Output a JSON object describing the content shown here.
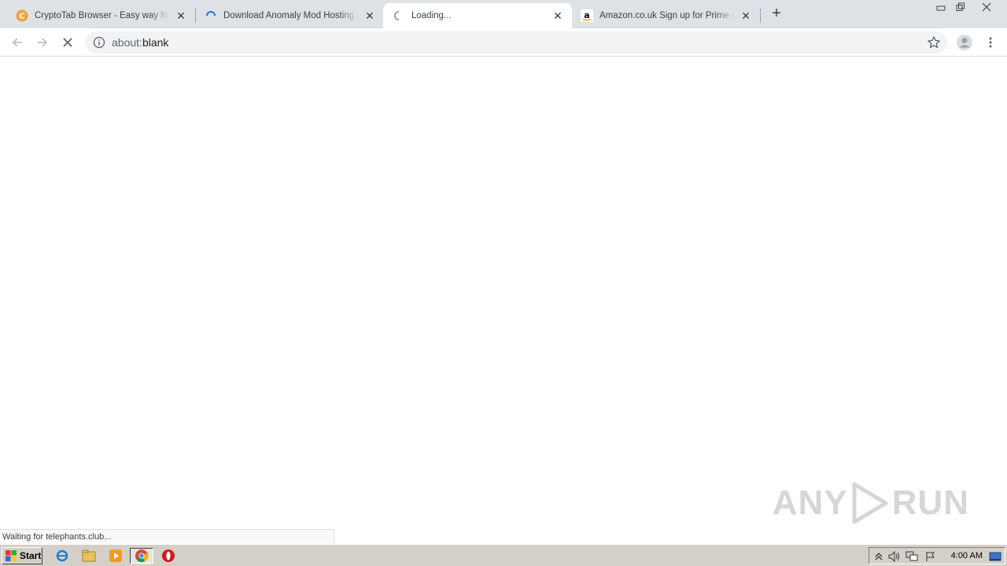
{
  "tabs": [
    {
      "title": "CryptoTab Browser - Easy way for B",
      "icon": "cryptotab-icon",
      "active": false
    },
    {
      "title": "Download Anomaly Mod Hosting mas",
      "icon": "loading-spinner-icon",
      "active": false
    },
    {
      "title": "Loading...",
      "icon": "loading-spinner-icon",
      "active": true
    },
    {
      "title": "Amazon.co.uk Sign up for Prime Inst",
      "icon": "amazon-icon",
      "active": false
    }
  ],
  "toolbar": {
    "url_scheme": "about:",
    "url_rest": "blank"
  },
  "status": {
    "text": "Waiting for telephants.club..."
  },
  "watermark": {
    "left": "ANY",
    "right": "RUN"
  },
  "taskbar": {
    "start_label": "Start",
    "clock": "4:00 AM"
  },
  "colors": {
    "accent": "#1a73e8",
    "tabstrip": "#dee1e6",
    "taskbar": "#d4d0c8"
  }
}
